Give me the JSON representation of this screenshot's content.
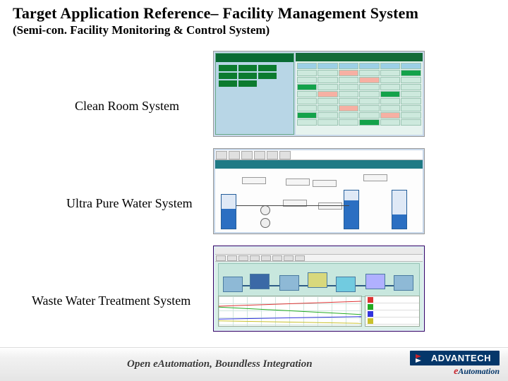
{
  "title": "Target Application Reference– Facility Management System",
  "subtitle": "(Semi-con. Facility Monitoring & Control System)",
  "systems": {
    "clean_room": "Clean Room System",
    "upw": "Ultra Pure Water System",
    "wwt": "Waste Water Treatment System"
  },
  "footer": {
    "tagline": "Open eAutomation, Boundless Integration",
    "brand_word": "ADVANTECH",
    "sub_e": "e",
    "sub_rest": "Automation"
  }
}
